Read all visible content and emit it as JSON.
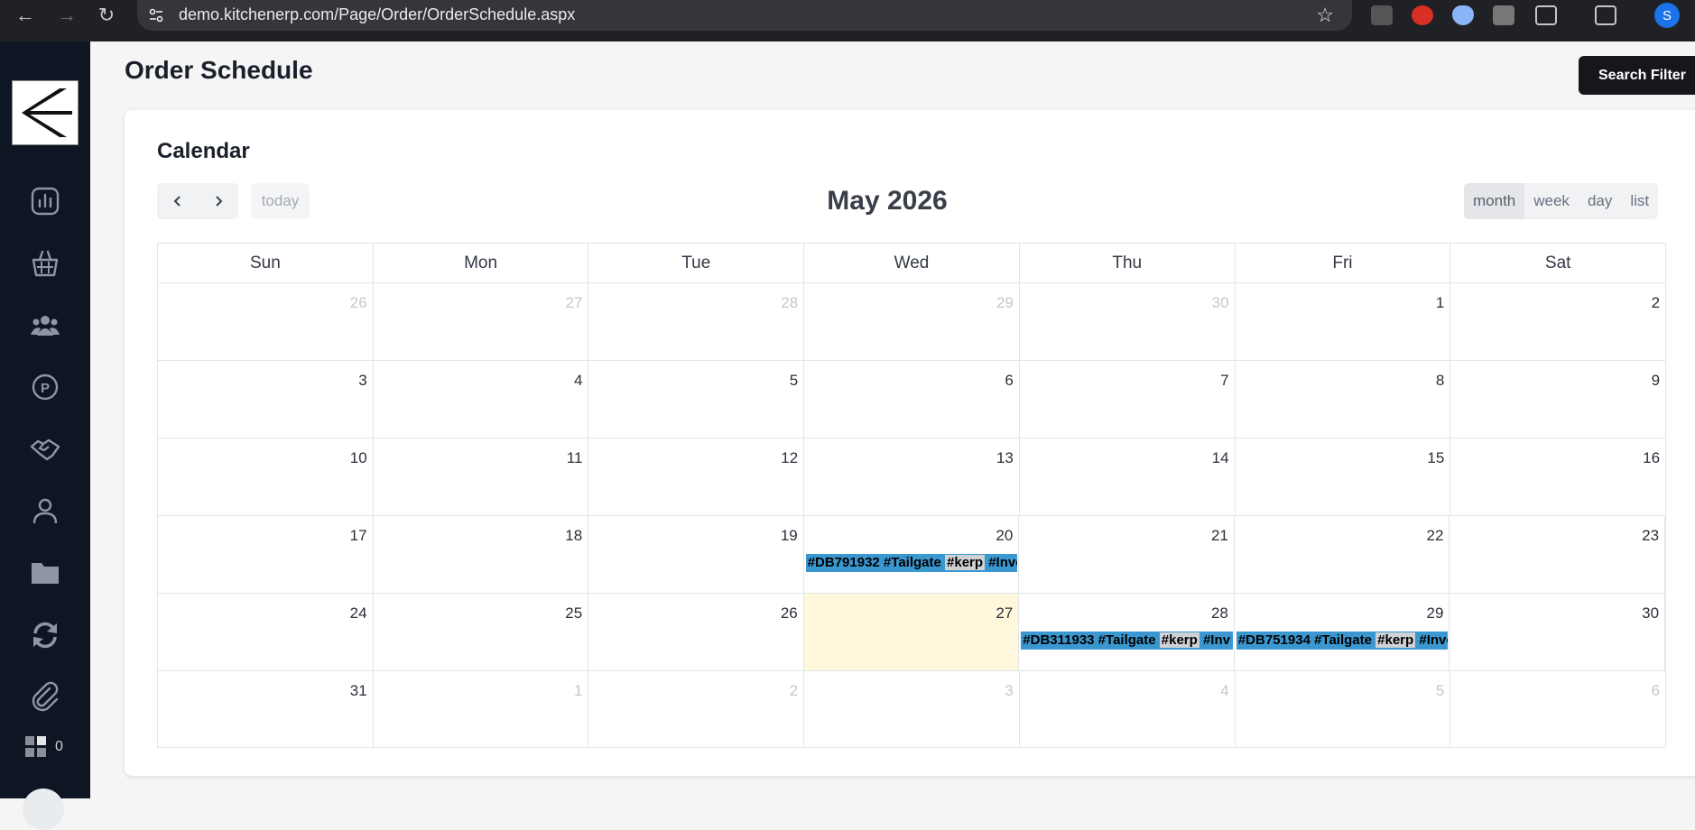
{
  "browser": {
    "url": "demo.kitchenerp.com/Page/Order/OrderSchedule.aspx",
    "profile_initial": "S"
  },
  "sidebar": {
    "items": [
      {
        "icon": "chart-icon"
      },
      {
        "icon": "basket-icon"
      },
      {
        "icon": "users-icon"
      },
      {
        "icon": "parking-icon"
      },
      {
        "icon": "handshake-icon"
      },
      {
        "icon": "user-icon"
      },
      {
        "icon": "folder-icon"
      },
      {
        "icon": "refresh-icon"
      },
      {
        "icon": "paperclip-icon"
      }
    ],
    "counter": "0"
  },
  "header": {
    "title": "Order Schedule",
    "search_filter_label": "Search Filter"
  },
  "calendar": {
    "title": "Calendar",
    "today_label": "today",
    "month_title": "May 2026",
    "views": [
      "month",
      "week",
      "day",
      "list"
    ],
    "active_view": "month",
    "weekdays": [
      "Sun",
      "Mon",
      "Tue",
      "Wed",
      "Thu",
      "Fri",
      "Sat"
    ],
    "weeks": [
      [
        {
          "d": "26",
          "o": true
        },
        {
          "d": "27",
          "o": true
        },
        {
          "d": "28",
          "o": true
        },
        {
          "d": "29",
          "o": true
        },
        {
          "d": "30",
          "o": true
        },
        {
          "d": "1"
        },
        {
          "d": "2"
        }
      ],
      [
        {
          "d": "3"
        },
        {
          "d": "4"
        },
        {
          "d": "5"
        },
        {
          "d": "6"
        },
        {
          "d": "7"
        },
        {
          "d": "8"
        },
        {
          "d": "9"
        }
      ],
      [
        {
          "d": "10"
        },
        {
          "d": "11"
        },
        {
          "d": "12"
        },
        {
          "d": "13"
        },
        {
          "d": "14"
        },
        {
          "d": "15"
        },
        {
          "d": "16"
        }
      ],
      [
        {
          "d": "17"
        },
        {
          "d": "18"
        },
        {
          "d": "19"
        },
        {
          "d": "20"
        },
        {
          "d": "21"
        },
        {
          "d": "22"
        },
        {
          "d": "23"
        }
      ],
      [
        {
          "d": "24"
        },
        {
          "d": "25"
        },
        {
          "d": "26"
        },
        {
          "d": "27",
          "t": true
        },
        {
          "d": "28"
        },
        {
          "d": "29"
        },
        {
          "d": "30"
        }
      ],
      [
        {
          "d": "31"
        },
        {
          "d": "1",
          "o": true
        },
        {
          "d": "2",
          "o": true
        },
        {
          "d": "3",
          "o": true
        },
        {
          "d": "4",
          "o": true
        },
        {
          "d": "5",
          "o": true
        },
        {
          "d": "6",
          "o": true
        }
      ]
    ],
    "events": [
      {
        "week": 3,
        "day": 3,
        "parts": [
          {
            "t": "#DB791932 #Tailgate "
          },
          {
            "t": "#kerp",
            "tag": true
          },
          {
            "t": " #Invoice"
          }
        ]
      },
      {
        "week": 4,
        "day": 4,
        "parts": [
          {
            "t": "#DB311933 #Tailgate "
          },
          {
            "t": "#kerp",
            "tag": true
          },
          {
            "t": " #Inv"
          }
        ]
      },
      {
        "week": 4,
        "day": 5,
        "parts": [
          {
            "t": "#DB751934 #Tailgate "
          },
          {
            "t": "#kerp",
            "tag": true
          },
          {
            "t": " #Invoice"
          }
        ]
      }
    ]
  }
}
